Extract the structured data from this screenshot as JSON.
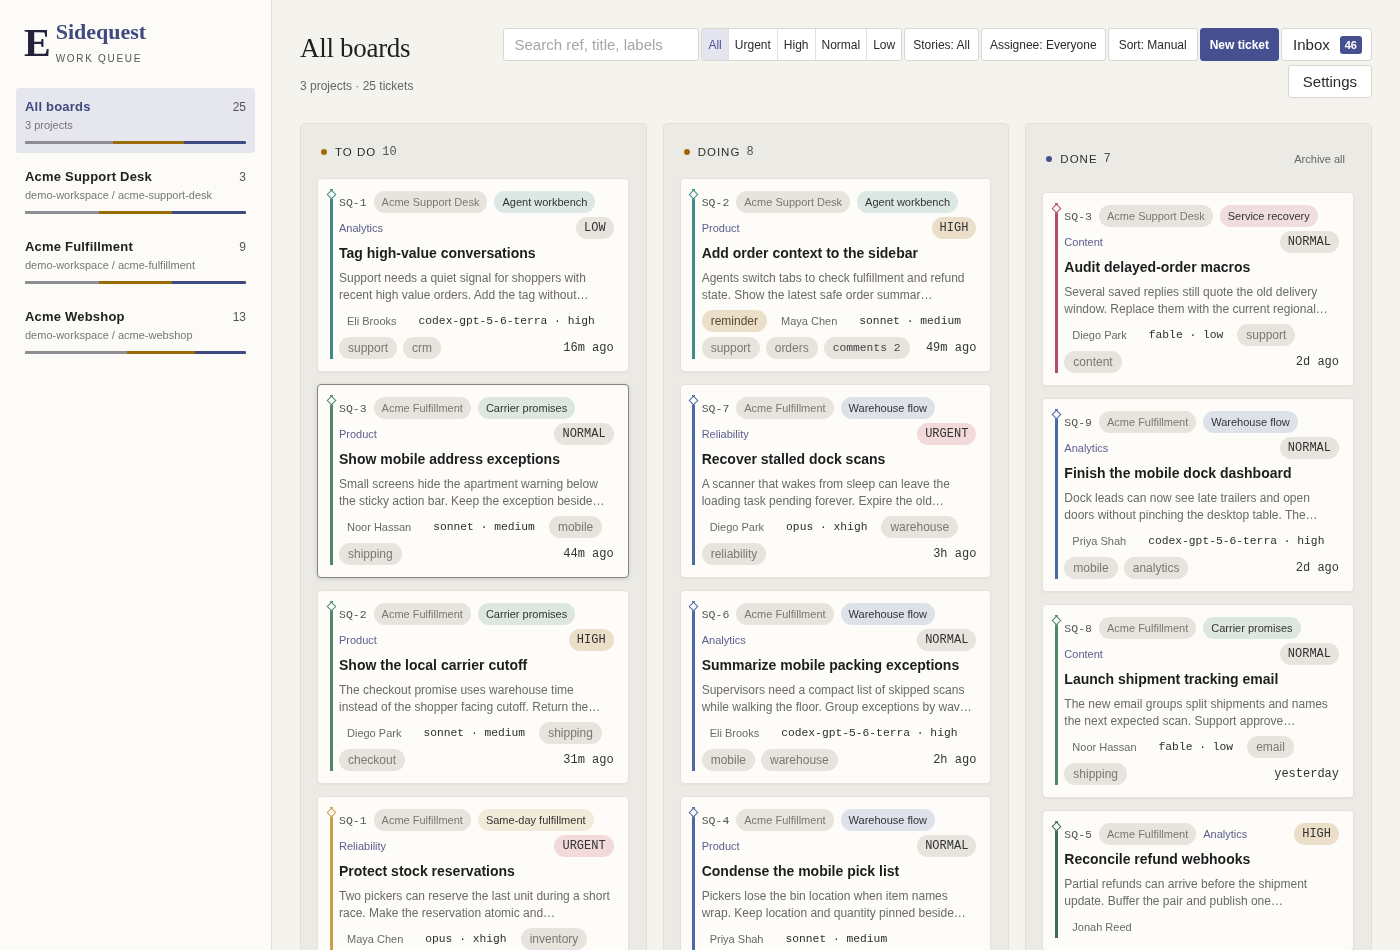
{
  "sidebar": {
    "brand": {
      "mark": "E",
      "name": "Sidequest",
      "tagline": "WORK QUEUE"
    },
    "nav": [
      {
        "name": "All boards",
        "count": "25",
        "subtitle": "3 projects",
        "selected": true,
        "bar": {
          "color": "#9a6b07",
          "segments": [
            {
              "kind": "start",
              "color": "#8e8d93",
              "level": 0.4
            },
            {
              "kind": "end",
              "color": "#3f4a80",
              "level": 0.28
            }
          ]
        }
      },
      {
        "name": "Acme Support Desk",
        "count": "3",
        "subtitle": "demo-workspace / acme-support-desk",
        "selected": false,
        "bar": {
          "color": "#9a6b07",
          "segments": [
            {
              "kind": "start",
              "color": "#8e8d93",
              "level": 0.334
            },
            {
              "kind": "end",
              "color": "#3f4a80",
              "level": 0.333
            }
          ]
        }
      },
      {
        "name": "Acme Fulfillment",
        "count": "9",
        "subtitle": "demo-workspace / acme-fulfillment",
        "selected": false,
        "bar": {
          "color": "#9a6b07",
          "segments": [
            {
              "kind": "start",
              "color": "#8e8d93",
              "level": 0.334
            },
            {
              "kind": "end",
              "color": "#3f4a80",
              "level": 0.333
            }
          ]
        }
      },
      {
        "name": "Acme Webshop",
        "count": "13",
        "subtitle": "demo-workspace / acme-webshop",
        "selected": false,
        "bar": {
          "color": "#9a6b07",
          "segments": [
            {
              "kind": "start",
              "color": "#8e8d93",
              "level": 0.46
            },
            {
              "kind": "end",
              "color": "#3f4a80",
              "level": 0.23
            }
          ]
        }
      }
    ]
  },
  "header": {
    "title": "All boards",
    "subtitle": "3 projects · 25 tickets"
  },
  "toolbar": {
    "search": {
      "placeholder": "Search ref, title, labels"
    },
    "priority_filter": [
      {
        "label": "All",
        "selected": true
      },
      {
        "label": "Urgent",
        "selected": false
      },
      {
        "label": "High",
        "selected": false
      },
      {
        "label": "Normal",
        "selected": false
      },
      {
        "label": "Low",
        "selected": false
      }
    ],
    "filters": [
      "Stories: All",
      "Assignee: Everyone",
      "Sort: Manual"
    ],
    "primary_button": "New ticket",
    "inbox": {
      "label": "Inbox",
      "count": "46"
    },
    "settings_button": "Settings"
  },
  "board": {
    "columns": [
      {
        "title": "TO DO",
        "count": "10",
        "color": "#9c6a08",
        "cards": [
          {
            "ref": "SQ-1",
            "project": "Acme Support Desk",
            "story": "Agent workbench",
            "color": "#3f8c86",
            "category": "Analytics",
            "priority": {
              "text": "LOW",
              "kind": "low"
            },
            "title": "Tag high-value conversations",
            "description": "Support needs a quiet signal for shoppers with recent high value orders. Add the tag without…",
            "assignee": "Eli Brooks",
            "model": "codex-gpt-5-6-terra · high",
            "tags": [
              "support",
              "crm"
            ],
            "time": "16m ago",
            "selected": false
          },
          {
            "ref": "SQ-3",
            "project": "Acme Fulfillment",
            "story": "Carrier promises",
            "color": "#4e8a68",
            "category": "Product",
            "priority": {
              "text": "NORMAL",
              "kind": "normal"
            },
            "title": "Show mobile address exceptions",
            "description": "Small screens hide the apartment warning below the sticky action bar. Keep the exception beside…",
            "assignee": "Noor Hassan",
            "model": "sonnet · medium",
            "tags": [
              "mobile",
              "shipping"
            ],
            "time": "44m ago",
            "selected": true
          },
          {
            "ref": "SQ-2",
            "project": "Acme Fulfillment",
            "story": "Carrier promises",
            "color": "#4e8a68",
            "category": "Product",
            "priority": {
              "text": "HIGH",
              "kind": "high"
            },
            "title": "Show the local carrier cutoff",
            "description": "The checkout promise uses warehouse time instead of the shopper facing cutoff. Return the…",
            "assignee": "Diego Park",
            "model": "sonnet · medium",
            "tags": [
              "shipping",
              "checkout"
            ],
            "time": "31m ago",
            "selected": false
          },
          {
            "ref": "SQ-1",
            "project": "Acme Fulfillment",
            "story": "Same-day fulfillment",
            "color": "#c8a04a",
            "category": "Reliability",
            "priority": {
              "text": "URGENT",
              "kind": "urgent"
            },
            "title": "Protect stock reservations",
            "description": "Two pickers can reserve the last unit during a short race. Make the reservation atomic and…",
            "assignee": "Maya Chen",
            "model": "opus · xhigh",
            "tags": [
              "inventory"
            ],
            "selected": false
          }
        ]
      },
      {
        "title": "DOING",
        "count": "8",
        "color": "#9c6a08",
        "cards": [
          {
            "ref": "SQ-2",
            "project": "Acme Support Desk",
            "story": "Agent workbench",
            "color": "#3f8c86",
            "category": "Product",
            "priority": {
              "text": "HIGH",
              "kind": "high"
            },
            "title": "Add order context to the sidebar",
            "description": "Agents switch tabs to check fulfillment and refund state. Show the latest safe order summar…",
            "flags": [
              "reminder"
            ],
            "assignee": "Maya Chen",
            "model": "sonnet · medium",
            "tags": [
              "support",
              "orders"
            ],
            "comments": "comments 2",
            "time": "49m ago",
            "selected": false
          },
          {
            "ref": "SQ-7",
            "project": "Acme Fulfillment",
            "story": "Warehouse flow",
            "color": "#4b6aa5",
            "category": "Reliability",
            "priority": {
              "text": "URGENT",
              "kind": "urgent"
            },
            "title": "Recover stalled dock scans",
            "description": "A scanner that wakes from sleep can leave the loading task pending forever. Expire the old…",
            "assignee": "Diego Park",
            "model": "opus · xhigh",
            "tags": [
              "warehouse",
              "reliability"
            ],
            "time": "3h ago",
            "selected": false
          },
          {
            "ref": "SQ-6",
            "project": "Acme Fulfillment",
            "story": "Warehouse flow",
            "color": "#4b6aa5",
            "category": "Analytics",
            "priority": {
              "text": "NORMAL",
              "kind": "normal"
            },
            "title": "Summarize mobile packing exceptions",
            "description": "Supervisors need a compact list of skipped scans while walking the floor. Group exceptions by wav…",
            "assignee": "Eli Brooks",
            "model": "codex-gpt-5-6-terra · high",
            "tags": [
              "mobile",
              "warehouse"
            ],
            "time": "2h ago",
            "selected": false
          },
          {
            "ref": "SQ-4",
            "project": "Acme Fulfillment",
            "story": "Warehouse flow",
            "color": "#4b6aa5",
            "category": "Product",
            "priority": {
              "text": "NORMAL",
              "kind": "normal"
            },
            "title": "Condense the mobile pick list",
            "description": "Pickers lose the bin location when item names wrap. Keep location and quantity pinned beside…",
            "assignee": "Priya Shah",
            "model": "sonnet · medium",
            "selected": false
          }
        ]
      },
      {
        "title": "DONE",
        "count": "7",
        "color": "#46508c",
        "action": "Archive all",
        "cards": [
          {
            "ref": "SQ-3",
            "project": "Acme Support Desk",
            "story": "Service recovery",
            "color": "#b24d6d",
            "category": "Content",
            "priority": {
              "text": "NORMAL",
              "kind": "normal"
            },
            "title": "Audit delayed-order macros",
            "description": "Several saved replies still quote the old delivery window. Replace them with the current regional…",
            "assignee": "Diego Park",
            "model": "fable · low",
            "tags": [
              "support",
              "content"
            ],
            "time": "2d ago",
            "selected": false
          },
          {
            "ref": "SQ-9",
            "project": "Acme Fulfillment",
            "story": "Warehouse flow",
            "color": "#4b6aa5",
            "category": "Analytics",
            "priority": {
              "text": "NORMAL",
              "kind": "normal"
            },
            "title": "Finish the mobile dock dashboard",
            "description": "Dock leads can now see late trailers and open doors without pinching the desktop table. The…",
            "assignee": "Priya Shah",
            "model": "codex-gpt-5-6-terra · high",
            "tags": [
              "mobile",
              "analytics"
            ],
            "time": "2d ago",
            "selected": false
          },
          {
            "ref": "SQ-8",
            "project": "Acme Fulfillment",
            "story": "Carrier promises",
            "color": "#4e8a68",
            "category": "Content",
            "priority": {
              "text": "NORMAL",
              "kind": "normal"
            },
            "title": "Launch shipment tracking email",
            "description": "The new email groups split shipments and names the next expected scan. Support approve…",
            "assignee": "Noor Hassan",
            "model": "fable · low",
            "tags": [
              "email",
              "shipping"
            ],
            "time": "yesterday",
            "selected": false
          },
          {
            "ref": "SQ-5",
            "project": "Acme Fulfillment",
            "color": "#3d6b53",
            "category": "Analytics",
            "priority": {
              "text": "HIGH",
              "kind": "high"
            },
            "title": "Reconcile refund webhooks",
            "description": "Partial refunds can arrive before the shipment update. Buffer the pair and publish one…",
            "assignee": "Jonah Reed",
            "selected": false
          }
        ]
      }
    ]
  }
}
